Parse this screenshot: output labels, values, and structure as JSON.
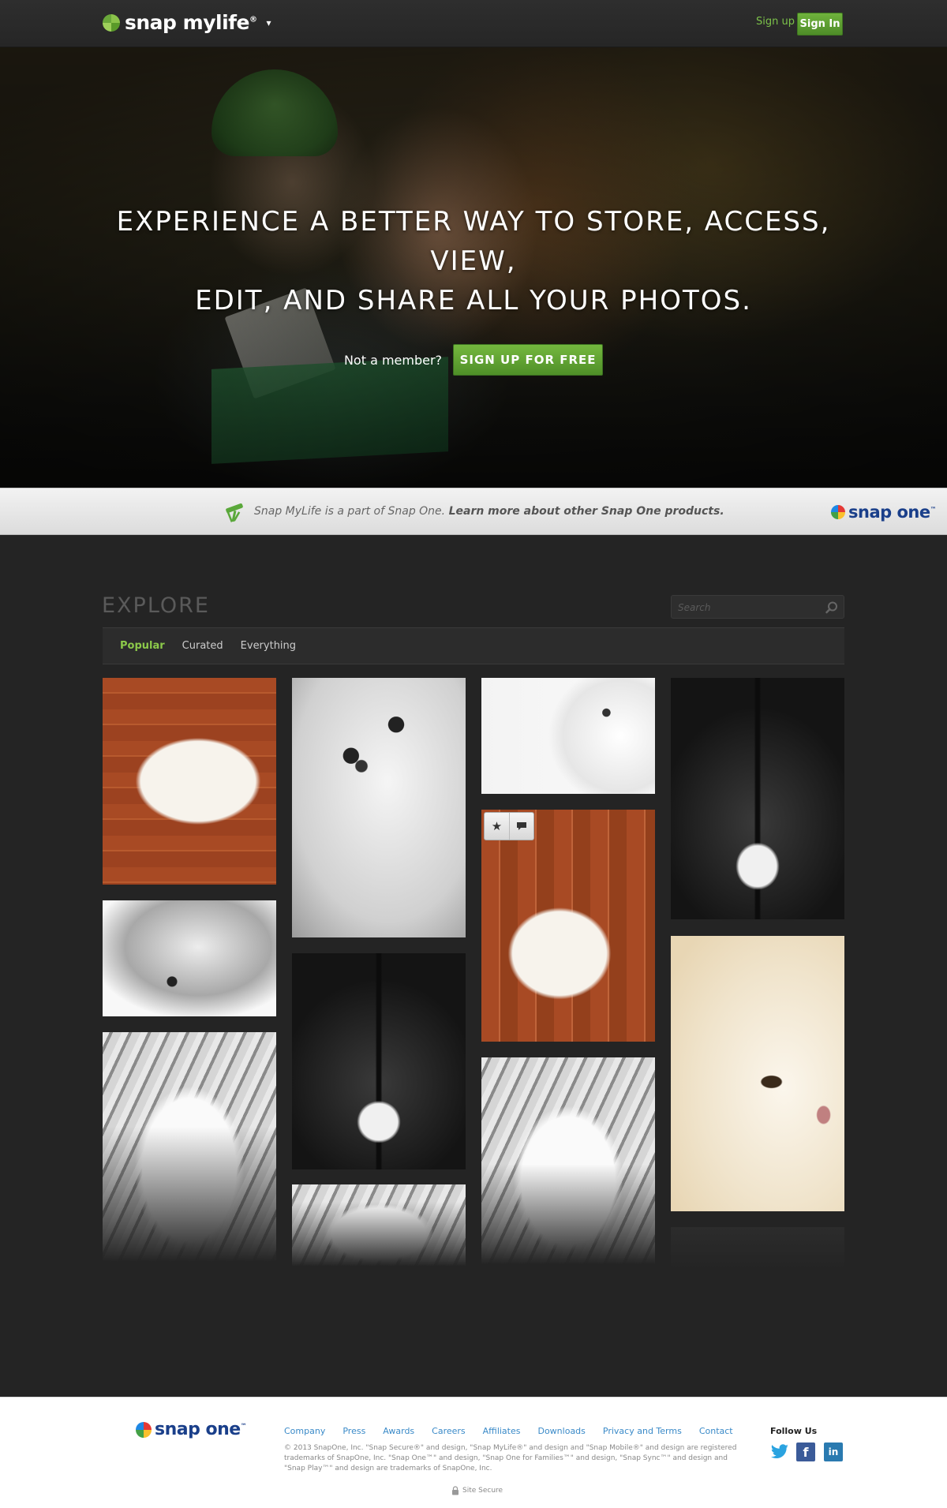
{
  "header": {
    "logo_text": "snap mylife",
    "logo_reg": "®",
    "signup_label": "Sign up",
    "signin_label": "Sign In"
  },
  "hero": {
    "headline_line1": "EXPERIENCE A BETTER WAY TO STORE, ACCESS, VIEW,",
    "headline_line2": "EDIT, AND SHARE ALL YOUR PHOTOS.",
    "not_member": "Not a member?",
    "cta_label": "SIGN UP FOR FREE"
  },
  "band": {
    "text_plain": "Snap MyLife is a part of Snap One.",
    "text_link": "Learn more about other Snap One products.",
    "logo_text": "snap one",
    "logo_tm": "™"
  },
  "explore": {
    "title": "EXPLORE",
    "search_placeholder": "Search",
    "tabs": [
      {
        "label": "Popular",
        "active": true
      },
      {
        "label": "Curated",
        "active": false
      },
      {
        "label": "Everything",
        "active": false
      }
    ]
  },
  "photo_actions": {
    "star_icon": "star-icon",
    "comment_icon": "comment-icon"
  },
  "footer": {
    "logo_text": "snap one",
    "logo_tm": "™",
    "links": [
      "Company",
      "Press",
      "Awards",
      "Careers",
      "Affiliates",
      "Downloads",
      "Privacy and Terms",
      "Contact"
    ],
    "legal": "© 2013 SnapOne, Inc. \"Snap Secure®\" and design, \"Snap MyLife®\" and design and \"Snap Mobile®\" and design are registered trademarks of SnapOne, Inc. \"Snap One™\" and design, \"Snap One for Families™\" and design, \"Snap Sync™\" and design and \"Snap Play™\" and design are trademarks of SnapOne, Inc.",
    "site_secure": "Site Secure",
    "follow_us": "Follow Us"
  },
  "colors": {
    "accent_green": "#6fb33c",
    "background": "#242424",
    "link_blue": "#3a8ac8",
    "brand_navy": "#1a3f8a"
  }
}
